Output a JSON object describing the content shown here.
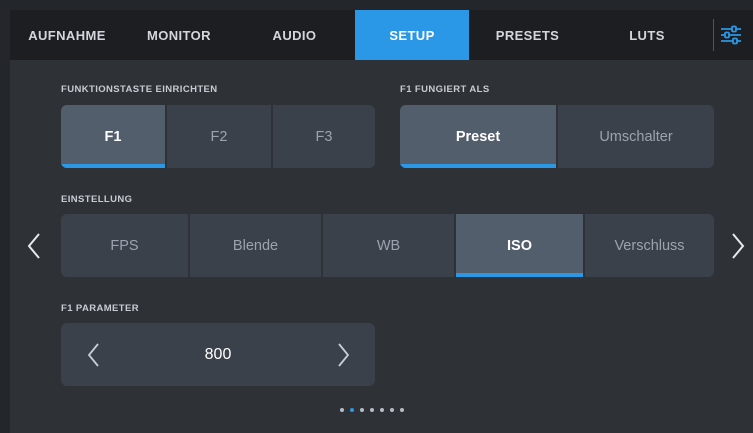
{
  "tabs": [
    {
      "label": "AUFNAHME"
    },
    {
      "label": "MONITOR"
    },
    {
      "label": "AUDIO"
    },
    {
      "label": "SETUP",
      "active": true
    },
    {
      "label": "PRESETS"
    },
    {
      "label": "LUTS"
    }
  ],
  "accent_color": "#2a98e6",
  "settings_icon": "sliders-icon",
  "function_key": {
    "label": "FUNKTIONSTASTE EINRICHTEN",
    "options": [
      "F1",
      "F2",
      "F3"
    ],
    "selected": "F1"
  },
  "function_mode": {
    "label": "F1 FUNGIERT ALS",
    "options": [
      "Preset",
      "Umschalter"
    ],
    "selected": "Preset"
  },
  "setting": {
    "label": "EINSTELLUNG",
    "options": [
      "FPS",
      "Blende",
      "WB",
      "ISO",
      "Verschluss"
    ],
    "selected": "ISO"
  },
  "parameter": {
    "label": "F1 PARAMETER",
    "value": "800"
  },
  "pagination": {
    "total": 7,
    "current": 2
  },
  "nav_icons": {
    "prev": "chevron-left-icon",
    "next": "chevron-right-icon"
  }
}
